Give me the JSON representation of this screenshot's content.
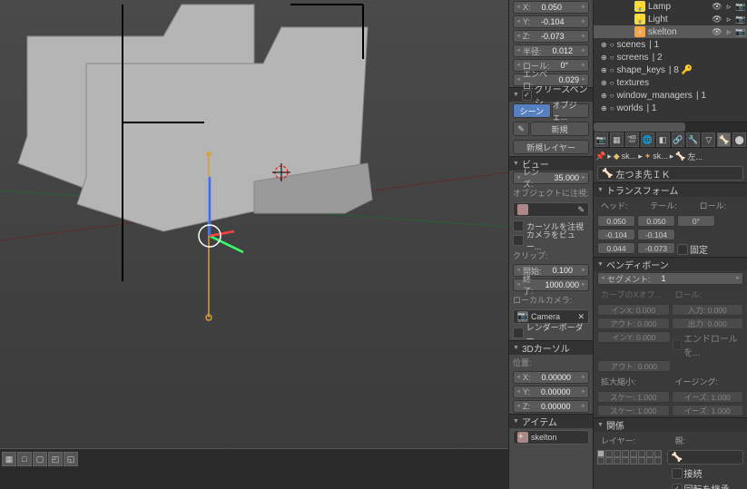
{
  "outliner": {
    "items": [
      {
        "icon": "💡",
        "iconColor": "#f4d942",
        "label": "Lamp",
        "indent": 45
      },
      {
        "icon": "💡",
        "iconColor": "#f4d942",
        "label": "Light",
        "indent": 45
      },
      {
        "icon": "✦",
        "iconColor": "#f4a442",
        "label": "skelton",
        "indent": 45,
        "selected": true
      }
    ],
    "categories": [
      {
        "label": "scenes",
        "count": 1
      },
      {
        "label": "screens",
        "count": 2
      },
      {
        "label": "shape_keys",
        "count": 8
      },
      {
        "label": "textures",
        "count": ""
      },
      {
        "label": "window_managers",
        "count": 1
      },
      {
        "label": "worlds",
        "count": 1
      }
    ]
  },
  "panel_n": {
    "transform": {
      "x": {
        "label": "X:",
        "value": "0.050"
      },
      "y": {
        "label": "Y:",
        "value": "-0.104"
      },
      "z": {
        "label": "Z:",
        "value": "-0.073"
      },
      "radius": {
        "label": "半径:",
        "value": "0.012"
      },
      "roll": {
        "label": "ロール:",
        "value": "0°"
      },
      "envelope": {
        "label": "エンベロ:",
        "value": "0.029"
      }
    },
    "grease": {
      "header": "グリースペンシ",
      "scene_btn": "シーン",
      "obj_btn": "オブジェ...",
      "new_btn": "新規",
      "new_layer": "新規レイヤー"
    },
    "view": {
      "header": "ビュー",
      "lens": {
        "label": "レンズ:",
        "value": "35.000"
      },
      "focus_obj": "オブジェクトに注視:",
      "lock_cursor": "カーソルを注視",
      "lock_camera": "カメラをビュー...",
      "clip": "クリップ:",
      "start": {
        "label": "開始:",
        "value": "0.100"
      },
      "end": {
        "label": "終了:",
        "value": "1000.000"
      },
      "local_cam": "ローカルカメラ:",
      "camera": "Camera",
      "render_border": "レンダーボーダー"
    },
    "cursor": {
      "header": "3Dカーソル",
      "pos": "位置:",
      "x": {
        "label": "X:",
        "value": "0.00000"
      },
      "y": {
        "label": "Y:",
        "value": "0.00000"
      },
      "z": {
        "label": "Z:",
        "value": "0.00000"
      }
    },
    "item": {
      "header": "アイテム",
      "name": "skelton"
    }
  },
  "props": {
    "breadcrumb": {
      "pin": "📌",
      "icon1": "🔗",
      "obj": "sk...",
      "icon2": "✦",
      "arm": "sk...",
      "bone": "左..."
    },
    "bone_name": "左つま先ＩＫ",
    "transform": {
      "header": "トランスフォーム",
      "head": "ヘッド:",
      "tail": "テール:",
      "roll": "ロール:",
      "r1": [
        "0.050",
        "0.050",
        "0°"
      ],
      "r2": [
        "-0.104",
        "-0.104"
      ],
      "r3": [
        "0.044",
        "-0.073"
      ],
      "lock": "固定"
    },
    "bendy": {
      "header": "ベンディボーン",
      "segment": {
        "label": "セグメント:",
        "value": "1"
      },
      "curve_x": "カーブのXオフ...",
      "roll": "ロール:",
      "in_x": {
        "label": "インX:",
        "value": "0.000"
      },
      "in_r": {
        "label": "入力:",
        "value": "0.000"
      },
      "out_x": {
        "label": "アウト:",
        "value": "0.000"
      },
      "out_r": {
        "label": "出力:",
        "value": "0.000"
      },
      "in_y": {
        "label": "インY:",
        "value": "0.000"
      },
      "endroll": "エンドロールを...",
      "out_y": {
        "label": "アウト:",
        "value": "0.000"
      },
      "scale": "拡大縮小:",
      "easing": "イージング:",
      "scale_in": {
        "label": "スケー:",
        "value": "1.000"
      },
      "ease_in": {
        "label": "イーズ:",
        "value": "1.000"
      },
      "scale_out": {
        "label": "スケー:",
        "value": "1.000"
      },
      "ease_out": {
        "label": "イーズ:",
        "value": "1.000"
      }
    },
    "relations": {
      "header": "関係",
      "layer": "レイヤー:",
      "parent": "親:",
      "connected": "接続",
      "inherit_rot": "回転を継承"
    }
  }
}
